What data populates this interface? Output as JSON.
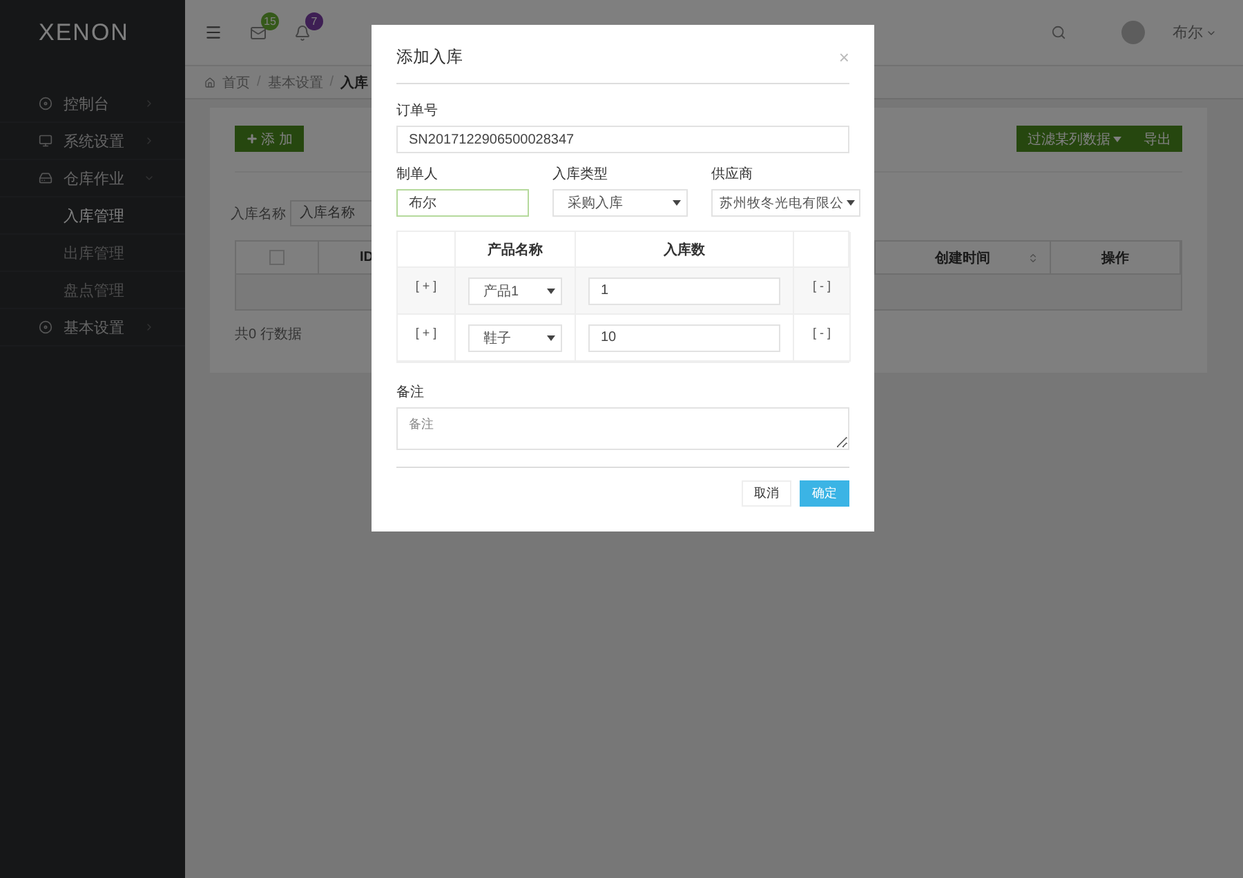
{
  "sidebar": {
    "logo": "XENON",
    "items": [
      {
        "label": "控制台",
        "expanded": false
      },
      {
        "label": "系统设置",
        "expanded": false
      },
      {
        "label": "仓库作业",
        "expanded": true,
        "children": [
          {
            "label": "入库管理",
            "selected": true
          },
          {
            "label": "出库管理",
            "selected": false
          },
          {
            "label": "盘点管理",
            "selected": false
          }
        ]
      },
      {
        "label": "基本设置",
        "expanded": false
      }
    ]
  },
  "topbar": {
    "mail_count": "15",
    "notification_count": "7",
    "user_name": "布尔"
  },
  "breadcrumb": {
    "separator": "/",
    "items": [
      "首页",
      "基本设置",
      "入库"
    ]
  },
  "toolbar": {
    "add_button": "添 加",
    "filter_button": "过滤某列数据",
    "export_button": "导出"
  },
  "search": {
    "label": "入库名称",
    "placeholder": "入库名称"
  },
  "table": {
    "select_all_checked": false,
    "columns": [
      {
        "label": "ID"
      },
      {
        "label": "创建时间",
        "sortable": true
      },
      {
        "label": "操作",
        "sortable": false
      }
    ]
  },
  "table_footer": "共0 行数据",
  "dialog": {
    "title": "添加入库",
    "close": "×",
    "order_no": {
      "label": "订单号",
      "value": "SN2017122906500028347"
    },
    "maker": {
      "label": "制单人",
      "value": "布尔",
      "focused": true
    },
    "stock_type": {
      "label": "入库类型",
      "value": "采购入库"
    },
    "supplier": {
      "label": "供应商",
      "value": "苏州牧冬光电有限公"
    },
    "items_table": {
      "columns": [
        "产品名称",
        "入库数"
      ],
      "rows": [
        {
          "add": "[ + ]",
          "product": "产品1",
          "quantity": "1",
          "remove": "[ - ]"
        },
        {
          "add": "[ + ]",
          "product": "鞋子",
          "quantity": "10",
          "remove": "[ - ]"
        }
      ]
    },
    "remark": {
      "label": "备注",
      "placeholder": "备注"
    },
    "buttons": {
      "cancel": "取消",
      "confirm": "确定"
    }
  }
}
